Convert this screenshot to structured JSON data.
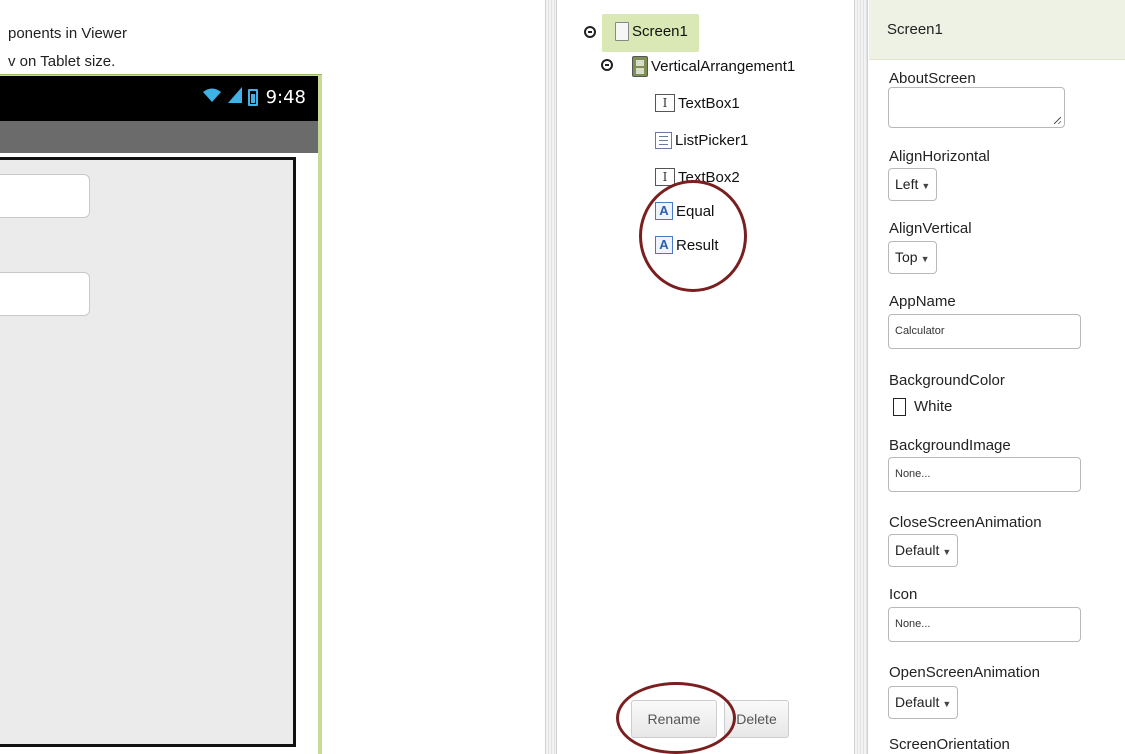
{
  "viewer": {
    "note_line1": "ponents in Viewer",
    "note_line2": "v on Tablet size.",
    "status_time": "9:48"
  },
  "components": {
    "tree": [
      {
        "label": "Screen1",
        "icon": "screen-icon"
      },
      {
        "label": "VerticalArrangement1",
        "icon": "vertical-arrangement-icon"
      },
      {
        "label": "TextBox1",
        "icon": "textbox-icon"
      },
      {
        "label": "ListPicker1",
        "icon": "listpicker-icon"
      },
      {
        "label": "TextBox2",
        "icon": "textbox-icon"
      },
      {
        "label": "Equal",
        "icon": "label-icon"
      },
      {
        "label": "Result",
        "icon": "label-icon"
      }
    ],
    "rename_label": "Rename",
    "delete_label": "Delete",
    "annotation_color": "#7a1f1f"
  },
  "properties": {
    "header": "Screen1",
    "about_screen": {
      "label": "AboutScreen",
      "value": ""
    },
    "align_horizontal": {
      "label": "AlignHorizontal",
      "value": "Left"
    },
    "align_vertical": {
      "label": "AlignVertical",
      "value": "Top"
    },
    "app_name": {
      "label": "AppName",
      "value": "Calculator"
    },
    "background_color": {
      "label": "BackgroundColor",
      "value": "White"
    },
    "background_image": {
      "label": "BackgroundImage",
      "value": "None..."
    },
    "close_screen_animation": {
      "label": "CloseScreenAnimation",
      "value": "Default"
    },
    "icon": {
      "label": "Icon",
      "value": "None..."
    },
    "open_screen_animation": {
      "label": "OpenScreenAnimation",
      "value": "Default"
    },
    "screen_orientation": {
      "label": "ScreenOrientation"
    }
  },
  "colors": {
    "phone_frame": "#c8db96",
    "selected_node": "#d9e8b4",
    "wifi_accent": "#3fb3e6"
  }
}
